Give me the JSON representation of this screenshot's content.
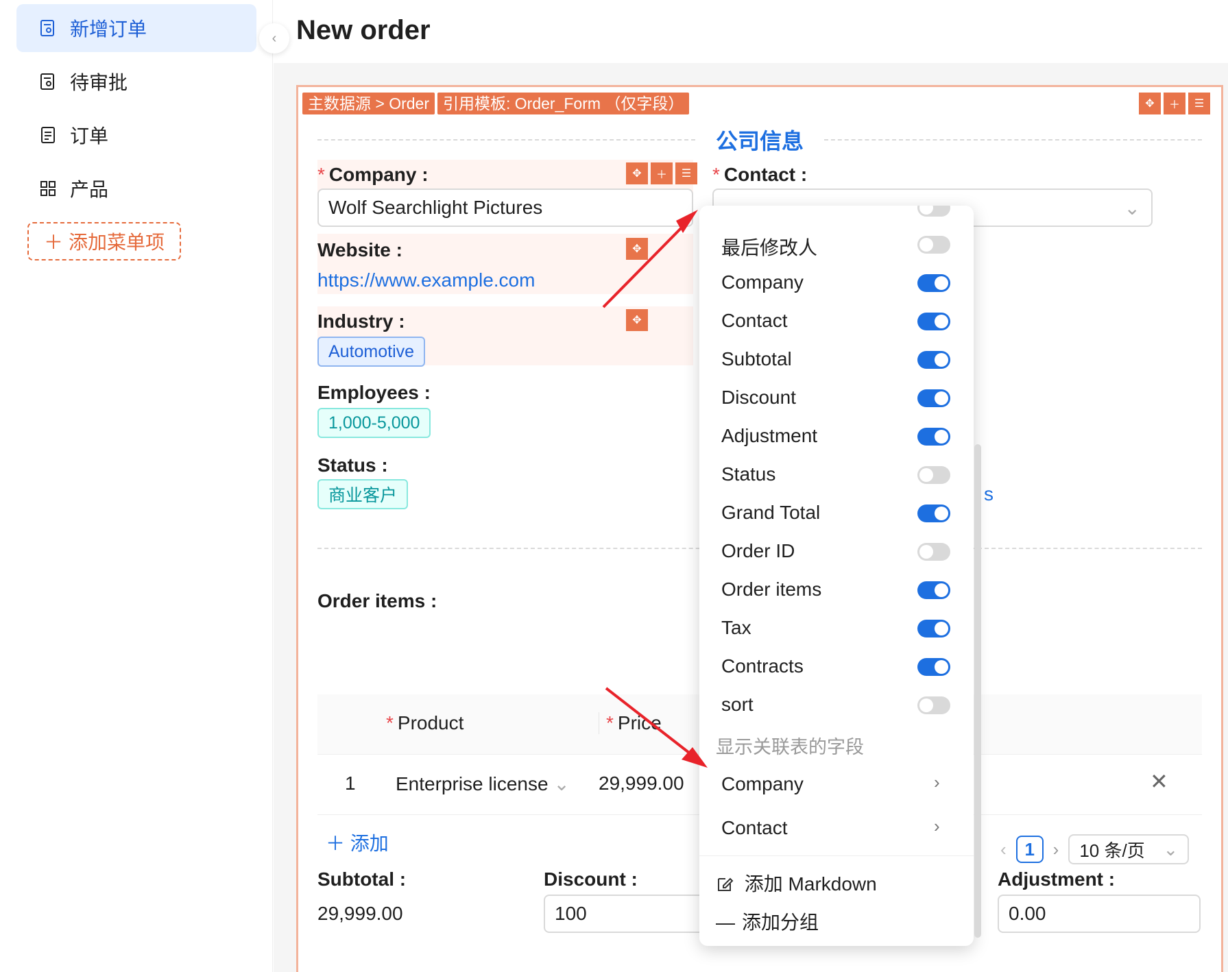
{
  "sidebar": {
    "items": [
      {
        "label": "新增订单",
        "icon": "form-icon",
        "active": true
      },
      {
        "label": "待审批",
        "icon": "form-icon"
      },
      {
        "label": "订单",
        "icon": "document-icon"
      },
      {
        "label": "产品",
        "icon": "grid-icon"
      }
    ],
    "add_label": "添加菜单项"
  },
  "header": {
    "title": "New order"
  },
  "card": {
    "source_tag": "主数据源 > Order",
    "template_tag": "引用模板: Order_Form （仅字段）",
    "section_title": "公司信息"
  },
  "fields": {
    "company": {
      "label": "Company",
      "value": "Wolf Searchlight Pictures"
    },
    "contact": {
      "label": "Contact"
    },
    "website": {
      "label": "Website",
      "value": "https://www.example.com"
    },
    "industry": {
      "label": "Industry",
      "value": "Automotive"
    },
    "employees": {
      "label": "Employees",
      "value": "1,000-5,000"
    },
    "status": {
      "label": "Status",
      "value": "商业客户"
    }
  },
  "order_items": {
    "label": "Order items",
    "columns": [
      "Product",
      "Price"
    ],
    "rows": [
      {
        "index": "1",
        "product": "Enterprise license",
        "price": "29,999.00"
      }
    ],
    "add_label": "添加",
    "pager": {
      "page": "1",
      "page_size": "10 条/页"
    }
  },
  "totals": {
    "subtotal_label": "Subtotal",
    "subtotal_value": "29,999.00",
    "discount_label": "Discount",
    "discount_value": "100",
    "adjustment_label": "Adjustment",
    "adjustment_value": "0.00"
  },
  "popup": {
    "toggles": [
      {
        "label": "最后修改人",
        "on": false
      },
      {
        "label": "Company",
        "on": true
      },
      {
        "label": "Contact",
        "on": true
      },
      {
        "label": "Subtotal",
        "on": true
      },
      {
        "label": "Discount",
        "on": true
      },
      {
        "label": "Adjustment",
        "on": true
      },
      {
        "label": "Status",
        "on": false
      },
      {
        "label": "Grand Total",
        "on": true
      },
      {
        "label": "Order ID",
        "on": false
      },
      {
        "label": "Order items",
        "on": true
      },
      {
        "label": "Tax",
        "on": true
      },
      {
        "label": "Contracts",
        "on": true
      },
      {
        "label": "sort",
        "on": false
      }
    ],
    "group_label": "显示关联表的字段",
    "relations": [
      "Company",
      "Contact"
    ],
    "actions": [
      "添加 Markdown",
      "添加分组"
    ]
  },
  "colors": {
    "accent": "#1d6fe0",
    "highlight": "#e8744a",
    "annotation": "#e8232a"
  }
}
